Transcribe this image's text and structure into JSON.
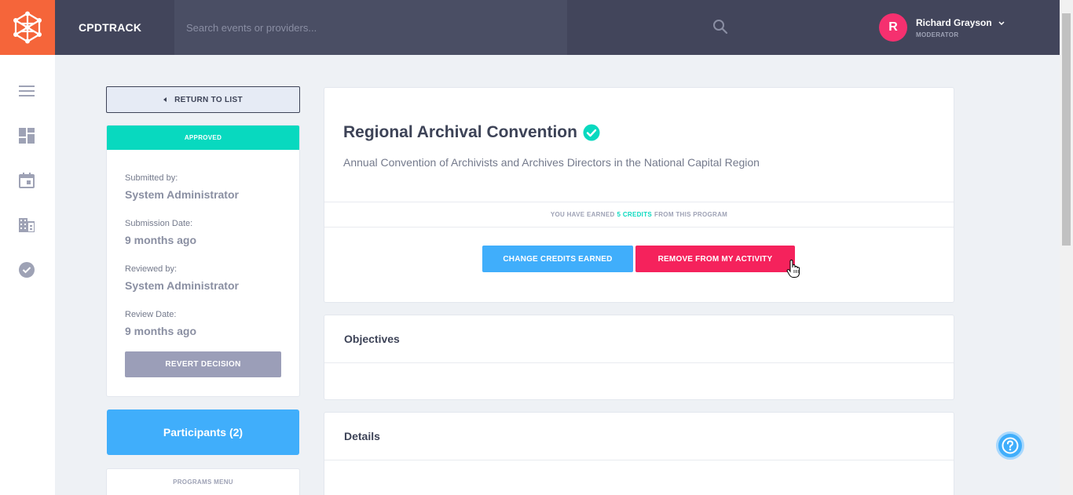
{
  "app": {
    "brand": "CPDTRACK"
  },
  "search": {
    "placeholder": "Search events or providers..."
  },
  "user": {
    "initial": "R",
    "name": "Richard Grayson",
    "role": "MODERATOR"
  },
  "sidebar": {
    "items": [
      {
        "icon": "menu-icon"
      },
      {
        "icon": "dashboard-icon"
      },
      {
        "icon": "calendar-icon"
      },
      {
        "icon": "building-icon"
      },
      {
        "icon": "check-circle-icon"
      }
    ]
  },
  "left": {
    "return_label": "RETURN TO LIST",
    "status": "APPROVED",
    "submitted_by_label": "Submitted by:",
    "submitted_by": "System Administrator",
    "submission_date_label": "Submission Date:",
    "submission_date": "9 months ago",
    "reviewed_by_label": "Reviewed by:",
    "reviewed_by": "System Administrator",
    "review_date_label": "Review Date:",
    "review_date": "9 months ago",
    "revert_label": "REVERT DECISION",
    "participants_label": "Participants (2)",
    "programs_menu_label": "PROGRAMS MENU"
  },
  "program": {
    "title": "Regional Archival Convention",
    "description": "Annual Convention of Archivists and Archives Directors in the National Capital Region",
    "credit_prefix": "YOU HAVE EARNED",
    "credit_value": "5 CREDITS",
    "credit_suffix": "FROM THIS PROGRAM",
    "change_label": "CHANGE CREDITS EARNED",
    "remove_label": "REMOVE FROM MY ACTIVITY"
  },
  "sections": {
    "objectives_title": "Objectives",
    "details_title": "Details"
  },
  "colors": {
    "topbar": "#42455b",
    "logo": "#f5653a",
    "approved": "#08d9bf",
    "primary": "#40aefb",
    "danger": "#f5225c",
    "avatar": "#f5306f"
  }
}
